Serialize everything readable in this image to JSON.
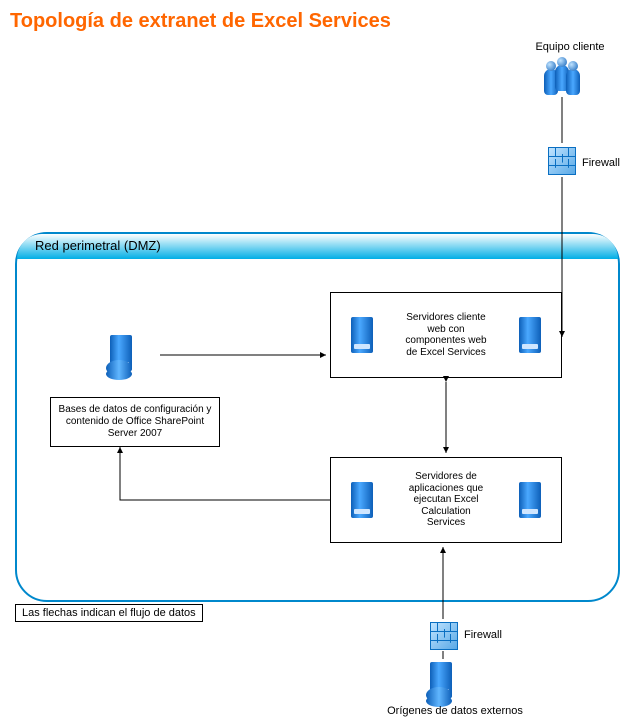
{
  "title": "Topología de extranet de Excel Services",
  "client_label": "Equipo cliente",
  "firewall_top_label": "Firewall",
  "dmz_title": "Red perimetral (DMZ)",
  "db_label": "Bases de datos de configuración y contenido de Office SharePoint Server 2007",
  "web_servers_label": "Servidores cliente web con componentes web de Excel Services",
  "app_servers_label": "Servidores de aplicaciones que ejecutan Excel Calculation Services",
  "firewall_bottom_label": "Firewall",
  "external_sources_label": "Orígenes de datos externos",
  "note": "Las flechas indican el flujo de datos"
}
